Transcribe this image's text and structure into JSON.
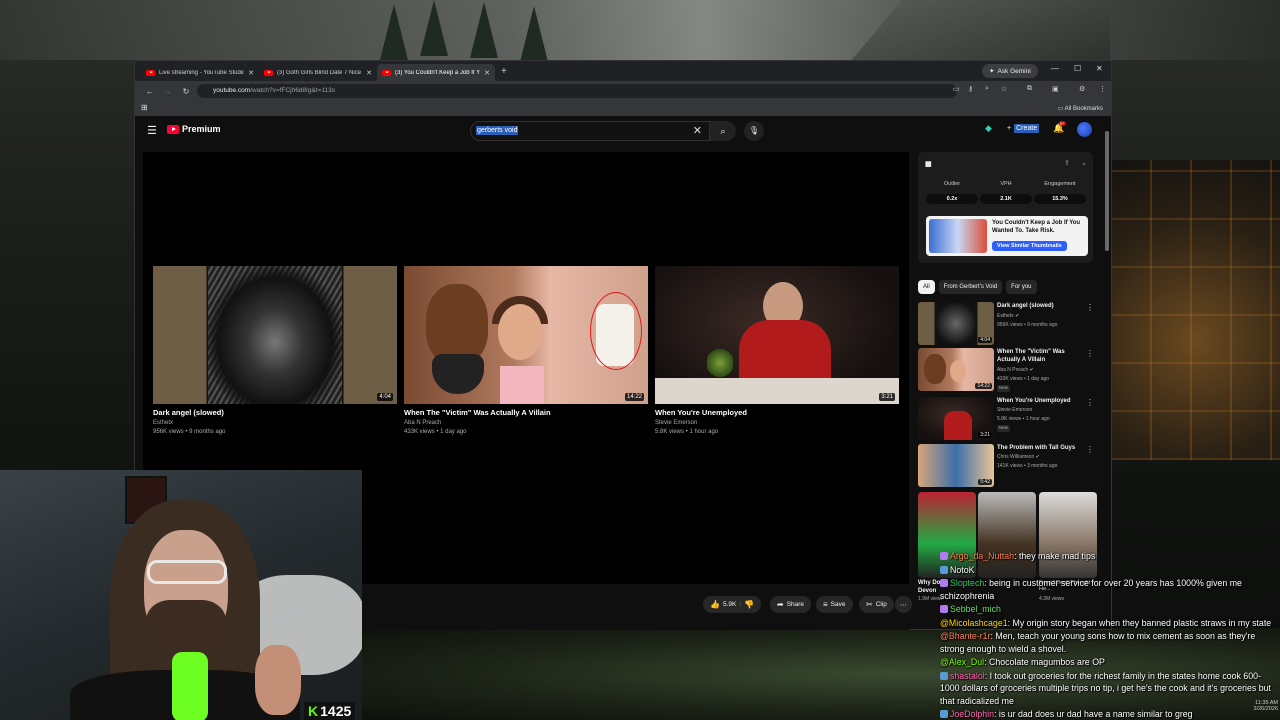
{
  "browser": {
    "tabs": [
      {
        "title": "Live streaming - YouTube Studio",
        "active": false
      },
      {
        "title": "(3) Goth Girls Blind Date 7 Nice",
        "active": false
      },
      {
        "title": "(3) You Couldn't Keep a Job If Y",
        "active": true
      }
    ],
    "new_tab": "+",
    "ask_gemini": "Ask Gemini",
    "url_domain": "youtube.com",
    "url_path": "/watch?v=fFCjh6d8Ig&t=113s",
    "all_bookmarks": "All Bookmarks"
  },
  "youtube": {
    "logo_text": "Premium",
    "search_query": "gerberts void",
    "create_label": "Create",
    "notification_count": "9+"
  },
  "endscreen": [
    {
      "title": "Dark angel (slowed)",
      "channel": "Esthetx",
      "meta": "956K views • 9 months ago",
      "duration": "4:04"
    },
    {
      "title": "When The \"Victim\" Was Actually A Villain",
      "channel": "Aba N Preach",
      "meta": "433K views • 1 day ago",
      "duration": "14:22"
    },
    {
      "title": "When You're Unemployed",
      "channel": "Stevie Emerson",
      "meta": "5.8K views • 1 hour ago",
      "duration": "3:21"
    }
  ],
  "actions": {
    "likes": "5.9K",
    "share": "Share",
    "save": "Save",
    "clip": "Clip",
    "more": "⋯"
  },
  "extension": {
    "stats": [
      {
        "label": "Outlier",
        "value": "0.2x"
      },
      {
        "label": "VPH",
        "value": "2.1K"
      },
      {
        "label": "Engagement",
        "value": "15.3%"
      }
    ],
    "card_title": "You Couldn't Keep a Job If You Wanted To. Take Risk.",
    "card_button": "View Similar Thumbnails"
  },
  "filter_chips": [
    "All",
    "From Gerbert's Void",
    "For you"
  ],
  "recommendations": [
    {
      "title": "Dark angel (slowed)",
      "channel": "Esthetx",
      "meta": "956K views • 9 months ago",
      "duration": "4:04",
      "new": ""
    },
    {
      "title": "When The \"Victim\" Was Actually A Villain",
      "channel": "Aba N Preach",
      "meta": "433K views • 1 day ago",
      "duration": "14:22",
      "new": "New"
    },
    {
      "title": "When You're Unemployed",
      "channel": "Stevie Emerson",
      "meta": "5.8K views • 1 hour ago",
      "duration": "3:21",
      "new": "New"
    },
    {
      "title": "The Problem with Tall Guys",
      "channel": "Chris Williamson",
      "meta": "141K views • 3 months ago",
      "duration": "5:42",
      "new": ""
    }
  ],
  "shorts_partial": {
    "title_fragment": "Why Do",
    "channel_fragment": "Devon",
    "views_fragment": "1.9M views",
    "right_fragment": "Even I Don't Thought He...",
    "right_views": "4.3M views"
  },
  "stream": {
    "sub_count": "1425",
    "badge_letter": "K"
  },
  "chat": [
    {
      "user": "Argo_da_Nuttah",
      "color": "#ff7f50",
      "text": "they make mad tips"
    },
    {
      "user": "NotoK",
      "color": "#ffffff",
      "text": ""
    },
    {
      "user": "Sloptech",
      "color": "#33cc66",
      "text": "being in customer service for over 20 years has 1000% given me schizophrenia"
    },
    {
      "user": "Sebbel_mich",
      "color": "#66e066",
      "text": ""
    },
    {
      "user": "@Micolashcage1",
      "color": "#ffd700",
      "text": "My origin story began when they banned plastic straws in my state"
    },
    {
      "user": "@Bhante-r1r",
      "color": "#ff7f50",
      "text": "Men, teach your young sons how to mix cement as soon as they're strong enough to wield a shovel."
    },
    {
      "user": "@Alex_Dul",
      "color": "#7fff00",
      "text": "Chocolate magumbos are OP"
    },
    {
      "user": "shastalol",
      "color": "#ff69b4",
      "text": "I took out groceries for the richest family in the states home cook 600-1000 dollars of groceries multiple trips no tip, i get he's the cook and it's groceries but that radicalized me"
    },
    {
      "user": "JoeDolphin",
      "color": "#ff69b4",
      "text": "is ur dad does ur dad have a name similar to greg"
    }
  ],
  "clock": {
    "time": "11:35 AM",
    "date": "3/26/2026"
  }
}
